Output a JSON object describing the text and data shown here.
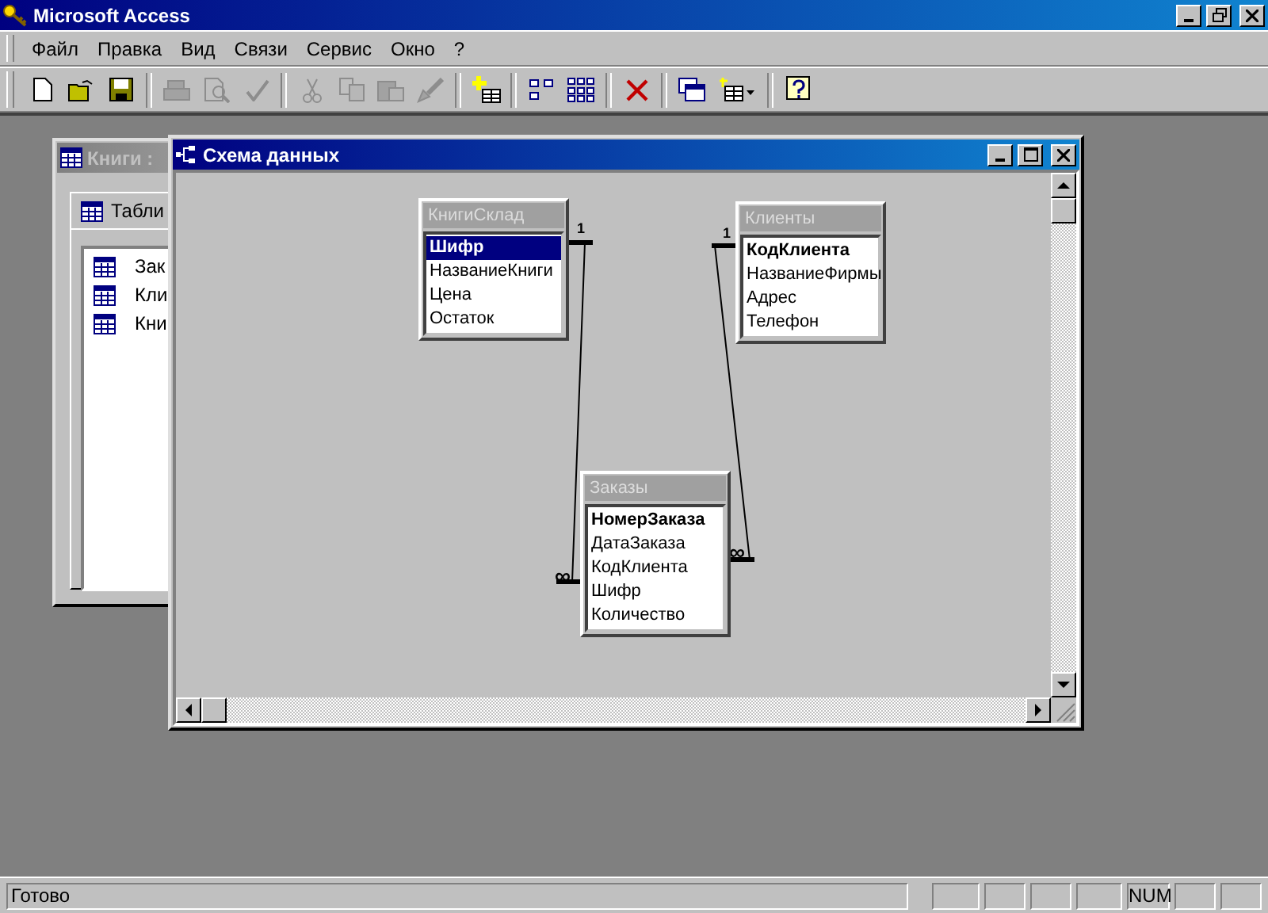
{
  "window": {
    "title": "Microsoft Access"
  },
  "menu": [
    "Файл",
    "Правка",
    "Вид",
    "Связи",
    "Сервис",
    "Окно",
    "?"
  ],
  "toolbar": [
    {
      "kind": "new",
      "disabled": false
    },
    {
      "kind": "open",
      "disabled": false
    },
    {
      "kind": "save",
      "disabled": false
    },
    {
      "kind": "sep"
    },
    {
      "kind": "print",
      "disabled": true
    },
    {
      "kind": "preview",
      "disabled": true
    },
    {
      "kind": "spelling",
      "disabled": true
    },
    {
      "kind": "sep"
    },
    {
      "kind": "cut",
      "disabled": true
    },
    {
      "kind": "copy",
      "disabled": true
    },
    {
      "kind": "paste",
      "disabled": true
    },
    {
      "kind": "brush",
      "disabled": true
    },
    {
      "kind": "sep"
    },
    {
      "kind": "add-table",
      "disabled": false
    },
    {
      "kind": "sep"
    },
    {
      "kind": "direct",
      "disabled": false
    },
    {
      "kind": "all",
      "disabled": false
    },
    {
      "kind": "sep"
    },
    {
      "kind": "delete",
      "disabled": false
    },
    {
      "kind": "sep"
    },
    {
      "kind": "db-window",
      "disabled": false
    },
    {
      "kind": "new-object",
      "disabled": false
    },
    {
      "kind": "sep"
    },
    {
      "kind": "help",
      "disabled": false
    }
  ],
  "database_window": {
    "title": "Книги :",
    "tab": "Табли",
    "items": [
      "Зак",
      "Кли",
      "Кни"
    ]
  },
  "schema_window": {
    "title": "Схема данных",
    "tables": [
      {
        "title": "КнигиСклад",
        "fields": [
          {
            "name": "Шифр",
            "key": true,
            "selected": true
          },
          {
            "name": "НазваниеКниги",
            "key": false,
            "selected": false
          },
          {
            "name": "Цена",
            "key": false,
            "selected": false
          },
          {
            "name": "Остаток",
            "key": false,
            "selected": false
          }
        ]
      },
      {
        "title": "Клиенты",
        "fields": [
          {
            "name": "КодКлиента",
            "key": true,
            "selected": false
          },
          {
            "name": "НазваниеФирмы",
            "key": false,
            "selected": false
          },
          {
            "name": "Адрес",
            "key": false,
            "selected": false
          },
          {
            "name": "Телефон",
            "key": false,
            "selected": false
          }
        ]
      },
      {
        "title": "Заказы",
        "fields": [
          {
            "name": "НомерЗаказа",
            "key": true,
            "selected": false
          },
          {
            "name": "ДатаЗаказа",
            "key": false,
            "selected": false
          },
          {
            "name": "КодКлиента",
            "key": false,
            "selected": false
          },
          {
            "name": "Шифр",
            "key": false,
            "selected": false
          },
          {
            "name": "Количество",
            "key": false,
            "selected": false
          }
        ]
      }
    ],
    "relationships": [
      {
        "one": "1",
        "many": "∞"
      },
      {
        "one": "1",
        "many": "∞"
      }
    ]
  },
  "status_bar": {
    "text": "Готово",
    "indicator": "NUM"
  }
}
